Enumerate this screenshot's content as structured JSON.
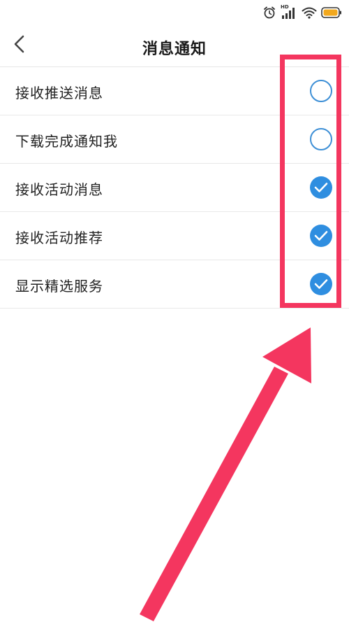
{
  "status_bar": {
    "network_label": "HD"
  },
  "header": {
    "title": "消息通知"
  },
  "settings": [
    {
      "label": "接收推送消息",
      "checked": false
    },
    {
      "label": "下载完成通知我",
      "checked": false
    },
    {
      "label": "接收活动消息",
      "checked": true
    },
    {
      "label": "接收活动推荐",
      "checked": true
    },
    {
      "label": "显示精选服务",
      "checked": true
    }
  ],
  "colors": {
    "accent": "#2f8ee0",
    "annotation": "#f4365f",
    "battery": "#f2a81d"
  },
  "icons": {
    "back": "chevron-left-icon",
    "alarm": "alarm-clock-icon",
    "signal": "cellular-signal-icon",
    "wifi": "wifi-icon",
    "battery": "battery-icon"
  }
}
